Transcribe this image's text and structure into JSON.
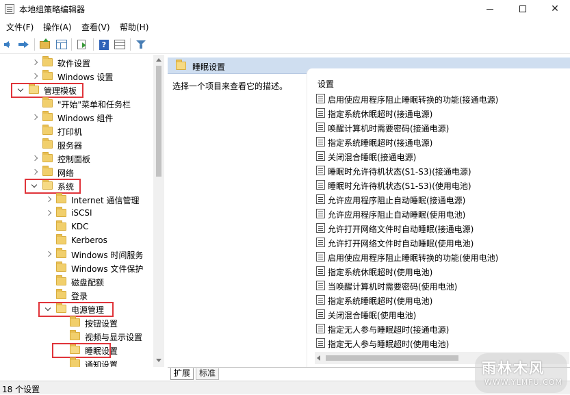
{
  "window": {
    "title": "本地组策略编辑器",
    "icon": "policy-editor-icon"
  },
  "menubar": {
    "items": [
      "文件(F)",
      "操作(A)",
      "查看(V)",
      "帮助(H)"
    ]
  },
  "toolbar": {
    "icons": [
      "back-arrow-icon",
      "forward-arrow-icon",
      "up-folder-icon",
      "show-hide-tree-icon",
      "export-list-icon",
      "help-icon",
      "properties-icon",
      "filter-icon"
    ]
  },
  "tree": {
    "items": [
      {
        "label": "软件设置",
        "level": 1,
        "expander": "closed"
      },
      {
        "label": "Windows 设置",
        "level": 1,
        "expander": "closed"
      },
      {
        "label": "管理模板",
        "level": 0,
        "expander": "open",
        "highlighted": true
      },
      {
        "label": "\"开始\"菜单和任务栏",
        "level": 1,
        "expander": "none"
      },
      {
        "label": "Windows 组件",
        "level": 1,
        "expander": "closed"
      },
      {
        "label": "打印机",
        "level": 1,
        "expander": "none"
      },
      {
        "label": "服务器",
        "level": 1,
        "expander": "none"
      },
      {
        "label": "控制面板",
        "level": 1,
        "expander": "closed"
      },
      {
        "label": "网络",
        "level": 1,
        "expander": "closed"
      },
      {
        "label": "系统",
        "level": 1,
        "expander": "open",
        "highlighted": true
      },
      {
        "label": "Internet 通信管理",
        "level": 2,
        "expander": "closed"
      },
      {
        "label": "iSCSI",
        "level": 2,
        "expander": "closed"
      },
      {
        "label": "KDC",
        "level": 2,
        "expander": "none"
      },
      {
        "label": "Kerberos",
        "level": 2,
        "expander": "none"
      },
      {
        "label": "Windows 时间服务",
        "level": 2,
        "expander": "closed"
      },
      {
        "label": "Windows 文件保护",
        "level": 2,
        "expander": "none"
      },
      {
        "label": "磁盘配额",
        "level": 2,
        "expander": "none"
      },
      {
        "label": "登录",
        "level": 2,
        "expander": "none"
      },
      {
        "label": "电源管理",
        "level": 2,
        "expander": "open",
        "highlighted": true
      },
      {
        "label": "按钮设置",
        "level": 3,
        "expander": "none"
      },
      {
        "label": "视频与显示设置",
        "level": 3,
        "expander": "none"
      },
      {
        "label": "睡眠设置",
        "level": 3,
        "expander": "none",
        "highlighted": true,
        "selected": true
      },
      {
        "label": "通知设置",
        "level": 3,
        "expander": "none"
      }
    ]
  },
  "details": {
    "header": "睡眠设置",
    "description": "选择一个项目来查看它的描述。",
    "column_header": "设置",
    "settings": [
      "启用使应用程序阻止睡眠转换的功能(接通电源)",
      "指定系统休眠超时(接通电源)",
      "唤醒计算机时需要密码(接通电源)",
      "指定系统睡眠超时(接通电源)",
      "关闭混合睡眠(接通电源)",
      "睡眠时允许待机状态(S1-S3)(接通电源)",
      "睡眠时允许待机状态(S1-S3)(使用电池)",
      "允许应用程序阻止自动睡眠(接通电源)",
      "允许应用程序阻止自动睡眠(使用电池)",
      "允许打开网络文件时自动睡眠(接通电源)",
      "允许打开网络文件时自动睡眠(使用电池)",
      "启用使应用程序阻止睡眠转换的功能(使用电池)",
      "指定系统休眠超时(使用电池)",
      "当唤醒计算机时需要密码(使用电池)",
      "指定系统睡眠超时(使用电池)",
      "关闭混合睡眠(使用电池)",
      "指定无人参与睡眠超时(接通电源)",
      "指定无人参与睡眠超时(使用电池)"
    ]
  },
  "tabs": [
    "扩展",
    "标准"
  ],
  "status": {
    "text": "18 个设置"
  },
  "watermark": {
    "main": "雨林木风",
    "sub": "WWW.YLMFU.COM"
  },
  "colors": {
    "highlight_border": "#e0343a",
    "details_header_bg": "#cfdef0",
    "folder": "#f1cf6c"
  }
}
